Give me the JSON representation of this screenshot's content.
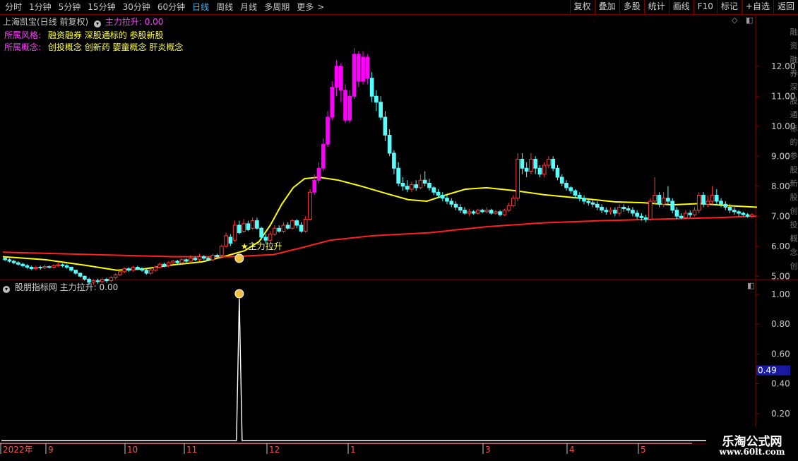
{
  "toolbar": {
    "periods": [
      "分时",
      "1分钟",
      "5分钟",
      "15分钟",
      "30分钟",
      "60分钟",
      "日线",
      "周线",
      "月线",
      "多周期",
      "更多"
    ],
    "active_period": "日线",
    "more_arrow": ">",
    "right_buttons": [
      "复权",
      "叠加",
      "多股",
      "统计",
      "画线",
      "F10",
      "标记",
      "+自选",
      "返回"
    ]
  },
  "main_panel": {
    "title": "上海凯宝(日线 前复权)",
    "indicator_label": "主力拉升: 0.00",
    "style_label": "所属风格:",
    "style_value": "融资融券 深股通标的 参股新股",
    "concept_label": "所属概念:",
    "concept_value": "创投概念 创新药 婴童概念 肝炎概念",
    "signal_text": "★主力拉升",
    "price_axis": [
      "12.00",
      "11.00",
      "10.00",
      "9.00",
      "8.00",
      "7.00",
      "6.00",
      "5.00"
    ],
    "right_strip_text": "融资融券深股通标的参股新股创投概念创新药婴童概念肝炎"
  },
  "sub_panel": {
    "title": "股朋指标网 主力拉升: 0.00",
    "axis": [
      "1.00",
      "0.80",
      "0.60",
      "0.40",
      "0.20"
    ],
    "current_value": "0.49"
  },
  "time_axis": [
    "2022年",
    "9",
    "10",
    "11",
    "12",
    "1",
    "3",
    "4",
    "5"
  ],
  "watermark": {
    "line1": "乐淘公式网",
    "line2": "www.60lt.com"
  },
  "colors": {
    "up": "#ff3c3c",
    "down": "#54ffff",
    "surge": "#ff00ff",
    "ma_short": "#ffff00",
    "ma_long": "#ff2020",
    "grid_border": "#8b0000",
    "highlight_value": "#1a1aa0"
  },
  "chart_data": {
    "type": "candlestick",
    "ylim": [
      4.5,
      12.6
    ],
    "x_ticks": [
      "2022年",
      "9",
      "10",
      "11",
      "12",
      "1",
      "3",
      "4",
      "5"
    ],
    "ma_short_points": [
      [
        0,
        5.65
      ],
      [
        30,
        5.55
      ],
      [
        60,
        5.35
      ],
      [
        80,
        5.2
      ],
      [
        100,
        5.25
      ],
      [
        120,
        5.38
      ],
      [
        140,
        5.48
      ],
      [
        155,
        5.65
      ],
      [
        170,
        5.85
      ],
      [
        180,
        6.15
      ],
      [
        188,
        6.7
      ],
      [
        196,
        7.4
      ],
      [
        204,
        7.95
      ],
      [
        212,
        8.25
      ],
      [
        222,
        8.3
      ],
      [
        236,
        8.2
      ],
      [
        252,
        8.0
      ],
      [
        270,
        7.75
      ],
      [
        285,
        7.55
      ],
      [
        298,
        7.5
      ],
      [
        312,
        7.72
      ],
      [
        325,
        7.9
      ],
      [
        340,
        7.95
      ],
      [
        360,
        7.85
      ],
      [
        380,
        7.72
      ],
      [
        410,
        7.58
      ],
      [
        430,
        7.48
      ],
      [
        450,
        7.45
      ],
      [
        470,
        7.38
      ],
      [
        490,
        7.42
      ],
      [
        510,
        7.35
      ],
      [
        530,
        7.3
      ]
    ],
    "ma_long_points": [
      [
        0,
        5.8
      ],
      [
        40,
        5.75
      ],
      [
        80,
        5.7
      ],
      [
        120,
        5.65
      ],
      [
        160,
        5.65
      ],
      [
        190,
        5.72
      ],
      [
        210,
        5.95
      ],
      [
        230,
        6.2
      ],
      [
        260,
        6.35
      ],
      [
        300,
        6.45
      ],
      [
        340,
        6.65
      ],
      [
        380,
        6.78
      ],
      [
        420,
        6.85
      ],
      [
        460,
        6.9
      ],
      [
        500,
        6.95
      ],
      [
        530,
        7.0
      ]
    ],
    "candles": [
      [
        5.6,
        5.55,
        5.65,
        5.5
      ],
      [
        5.55,
        5.5,
        5.6,
        5.45
      ],
      [
        5.5,
        5.45,
        5.55,
        5.4
      ],
      [
        5.45,
        5.4,
        5.5,
        5.35
      ],
      [
        5.4,
        5.35,
        5.45,
        5.3
      ],
      [
        5.35,
        5.3,
        5.4,
        5.25
      ],
      [
        5.3,
        5.25,
        5.35,
        5.2
      ],
      [
        5.25,
        5.3,
        5.35,
        5.2
      ],
      [
        5.3,
        5.28,
        5.35,
        5.22
      ],
      [
        5.28,
        5.32,
        5.38,
        5.24
      ],
      [
        5.32,
        5.3,
        5.36,
        5.26
      ],
      [
        5.3,
        5.35,
        5.4,
        5.26
      ],
      [
        5.35,
        5.38,
        5.45,
        5.3
      ],
      [
        5.38,
        5.35,
        5.42,
        5.3
      ],
      [
        5.35,
        5.3,
        5.4,
        5.25
      ],
      [
        5.3,
        5.2,
        5.32,
        5.15
      ],
      [
        5.2,
        5.1,
        5.22,
        5.05
      ],
      [
        5.1,
        5.0,
        5.12,
        4.95
      ],
      [
        5.0,
        4.9,
        5.02,
        4.85
      ],
      [
        4.9,
        4.8,
        4.95,
        4.7
      ],
      [
        4.8,
        4.85,
        4.9,
        4.72
      ],
      [
        4.85,
        4.82,
        4.92,
        4.75
      ],
      [
        4.82,
        4.9,
        4.95,
        4.78
      ],
      [
        4.9,
        4.85,
        4.95,
        4.78
      ],
      [
        4.85,
        4.95,
        5.0,
        4.8
      ],
      [
        4.95,
        5.05,
        5.1,
        4.9
      ],
      [
        5.05,
        5.15,
        5.2,
        5.0
      ],
      [
        5.15,
        5.25,
        5.3,
        5.1
      ],
      [
        5.25,
        5.2,
        5.3,
        5.15
      ],
      [
        5.2,
        5.3,
        5.35,
        5.15
      ],
      [
        5.3,
        5.25,
        5.35,
        5.2
      ],
      [
        5.25,
        5.2,
        5.3,
        5.15
      ],
      [
        5.2,
        5.1,
        5.25,
        5.05
      ],
      [
        5.1,
        5.2,
        5.25,
        5.05
      ],
      [
        5.2,
        5.3,
        5.35,
        5.15
      ],
      [
        5.3,
        5.4,
        5.45,
        5.25
      ],
      [
        5.4,
        5.35,
        5.45,
        5.3
      ],
      [
        5.35,
        5.45,
        5.5,
        5.3
      ],
      [
        5.45,
        5.5,
        5.55,
        5.4
      ],
      [
        5.5,
        5.45,
        5.55,
        5.4
      ],
      [
        5.45,
        5.55,
        5.6,
        5.4
      ],
      [
        5.55,
        5.5,
        5.6,
        5.45
      ],
      [
        5.5,
        5.6,
        5.7,
        5.45
      ],
      [
        5.6,
        5.55,
        5.65,
        5.5
      ],
      [
        5.55,
        5.65,
        5.75,
        5.5
      ],
      [
        5.65,
        5.6,
        5.7,
        5.55
      ],
      [
        5.6,
        5.55,
        5.65,
        5.5
      ],
      [
        5.55,
        5.7,
        5.75,
        5.5
      ],
      [
        5.7,
        5.65,
        5.75,
        5.6
      ],
      [
        5.7,
        6.0,
        6.05,
        5.65
      ],
      [
        6.0,
        6.35,
        6.45,
        5.95
      ],
      [
        6.3,
        6.1,
        6.4,
        6.0
      ],
      [
        6.2,
        6.7,
        6.85,
        6.15
      ],
      [
        6.7,
        6.45,
        6.85,
        6.4
      ],
      [
        6.5,
        6.75,
        6.9,
        6.45
      ],
      [
        6.75,
        6.55,
        6.85,
        6.5
      ],
      [
        6.6,
        6.85,
        6.95,
        6.55
      ],
      [
        6.85,
        6.6,
        6.95,
        6.55
      ],
      [
        6.6,
        6.3,
        6.65,
        6.2
      ],
      [
        6.3,
        6.2,
        6.4,
        6.1
      ],
      [
        6.2,
        6.4,
        6.5,
        6.15
      ],
      [
        6.4,
        6.6,
        6.7,
        6.35
      ],
      [
        6.6,
        6.5,
        6.7,
        6.45
      ],
      [
        6.5,
        6.7,
        6.8,
        6.45
      ],
      [
        6.7,
        6.6,
        6.8,
        6.55
      ],
      [
        6.6,
        6.85,
        6.9,
        6.55
      ],
      [
        6.85,
        6.7,
        6.9,
        6.6
      ],
      [
        6.7,
        6.5,
        6.8,
        6.45
      ],
      [
        6.5,
        6.9,
        7.0,
        6.45
      ],
      [
        6.9,
        7.8,
        7.9,
        6.85
      ],
      [
        7.8,
        8.2,
        8.4,
        7.7
      ],
      [
        8.2,
        8.6,
        8.8,
        8.1
      ],
      [
        8.6,
        9.4,
        9.6,
        8.5
      ],
      [
        9.4,
        10.3,
        10.5,
        9.3
      ],
      [
        10.3,
        11.3,
        11.5,
        10.2
      ],
      [
        11.3,
        12.0,
        12.2,
        11.0
      ],
      [
        12.0,
        11.2,
        12.1,
        10.8
      ],
      [
        11.2,
        10.2,
        11.4,
        10.1
      ],
      [
        10.2,
        11.0,
        11.2,
        10.1
      ],
      [
        11.0,
        12.4,
        12.6,
        10.9
      ],
      [
        12.4,
        11.5,
        12.5,
        11.3
      ],
      [
        11.5,
        12.3,
        12.5,
        11.4
      ],
      [
        12.3,
        11.6,
        12.4,
        11.4
      ],
      [
        11.6,
        11.0,
        11.8,
        10.8
      ],
      [
        11.0,
        10.8,
        11.2,
        10.5
      ],
      [
        10.8,
        10.3,
        11.0,
        10.2
      ],
      [
        10.3,
        9.7,
        10.5,
        9.5
      ],
      [
        9.7,
        9.1,
        9.9,
        9.0
      ],
      [
        9.1,
        8.6,
        9.2,
        8.4
      ],
      [
        8.6,
        8.1,
        8.8,
        8.0
      ],
      [
        8.1,
        8.0,
        8.3,
        7.85
      ],
      [
        8.0,
        7.9,
        8.2,
        7.8
      ],
      [
        7.9,
        8.05,
        8.15,
        7.8
      ],
      [
        8.05,
        7.95,
        8.2,
        7.85
      ],
      [
        7.95,
        8.2,
        8.4,
        7.9
      ],
      [
        8.2,
        8.1,
        8.5,
        8.0
      ],
      [
        8.1,
        7.95,
        8.25,
        7.85
      ],
      [
        7.95,
        7.8,
        8.0,
        7.7
      ],
      [
        7.8,
        7.7,
        7.9,
        7.6
      ],
      [
        7.7,
        7.6,
        7.8,
        7.5
      ],
      [
        7.6,
        7.5,
        7.7,
        7.4
      ],
      [
        7.5,
        7.4,
        7.6,
        7.3
      ],
      [
        7.4,
        7.3,
        7.5,
        7.2
      ],
      [
        7.3,
        7.2,
        7.4,
        7.1
      ],
      [
        7.2,
        7.1,
        7.3,
        7.05
      ],
      [
        7.1,
        7.15,
        7.25,
        7.0
      ],
      [
        7.15,
        7.1,
        7.2,
        7.05
      ],
      [
        7.1,
        7.2,
        7.25,
        7.05
      ],
      [
        7.2,
        7.15,
        7.25,
        7.1
      ],
      [
        7.15,
        7.2,
        7.3,
        7.1
      ],
      [
        7.2,
        7.1,
        7.25,
        7.05
      ],
      [
        7.1,
        7.15,
        7.2,
        7.05
      ],
      [
        7.15,
        7.05,
        7.2,
        7.0
      ],
      [
        7.05,
        7.2,
        7.25,
        7.0
      ],
      [
        7.2,
        7.35,
        7.45,
        7.15
      ],
      [
        7.35,
        7.6,
        7.7,
        7.3
      ],
      [
        7.6,
        8.9,
        9.1,
        7.5
      ],
      [
        8.9,
        8.6,
        9.1,
        8.4
      ],
      [
        8.6,
        8.5,
        8.8,
        8.3
      ],
      [
        8.5,
        8.9,
        9.1,
        8.4
      ],
      [
        8.9,
        8.6,
        9.0,
        8.4
      ],
      [
        8.6,
        8.4,
        8.7,
        8.3
      ],
      [
        8.4,
        8.7,
        8.8,
        8.3
      ],
      [
        8.7,
        8.9,
        9.0,
        8.6
      ],
      [
        8.9,
        8.6,
        9.0,
        8.5
      ],
      [
        8.6,
        8.3,
        8.7,
        8.2
      ],
      [
        8.3,
        8.1,
        8.4,
        8.0
      ],
      [
        8.1,
        7.95,
        8.2,
        7.85
      ],
      [
        7.95,
        7.85,
        8.0,
        7.75
      ],
      [
        7.85,
        7.7,
        7.9,
        7.6
      ],
      [
        7.7,
        7.6,
        7.8,
        7.5
      ],
      [
        7.6,
        7.5,
        7.7,
        7.4
      ],
      [
        7.5,
        7.45,
        7.6,
        7.35
      ],
      [
        7.45,
        7.4,
        7.55,
        7.3
      ],
      [
        7.4,
        7.3,
        7.5,
        7.2
      ],
      [
        7.3,
        7.2,
        7.4,
        7.1
      ],
      [
        7.2,
        7.15,
        7.3,
        7.05
      ],
      [
        7.15,
        7.2,
        7.3,
        7.05
      ],
      [
        7.2,
        7.1,
        7.3,
        7.0
      ],
      [
        7.1,
        7.3,
        7.4,
        7.0
      ],
      [
        7.3,
        7.25,
        7.4,
        7.15
      ],
      [
        7.25,
        7.2,
        7.35,
        7.1
      ],
      [
        7.2,
        7.1,
        7.3,
        7.0
      ],
      [
        7.1,
        7.0,
        7.2,
        6.9
      ],
      [
        7.0,
        6.95,
        7.1,
        6.85
      ],
      [
        6.95,
        6.9,
        7.05,
        6.8
      ],
      [
        6.9,
        7.5,
        7.6,
        6.85
      ],
      [
        7.5,
        7.7,
        8.3,
        7.4
      ],
      [
        7.7,
        7.4,
        7.8,
        7.3
      ],
      [
        7.4,
        7.6,
        7.8,
        7.3
      ],
      [
        7.6,
        7.5,
        8.0,
        7.4
      ],
      [
        7.5,
        7.2,
        7.6,
        7.1
      ],
      [
        7.2,
        7.0,
        7.3,
        6.9
      ],
      [
        7.0,
        6.95,
        7.1,
        6.9
      ],
      [
        6.95,
        7.1,
        7.2,
        6.9
      ],
      [
        7.1,
        7.05,
        7.2,
        6.95
      ],
      [
        7.05,
        7.2,
        7.3,
        7.0
      ],
      [
        7.2,
        7.7,
        7.8,
        7.1
      ],
      [
        7.7,
        7.4,
        7.8,
        7.3
      ],
      [
        7.4,
        7.5,
        7.7,
        7.3
      ],
      [
        7.5,
        7.7,
        8.0,
        7.4
      ],
      [
        7.7,
        7.5,
        7.9,
        7.4
      ],
      [
        7.5,
        7.4,
        7.6,
        7.3
      ],
      [
        7.4,
        7.3,
        7.5,
        7.2
      ],
      [
        7.3,
        7.2,
        7.4,
        7.1
      ],
      [
        7.2,
        7.15,
        7.3,
        7.05
      ],
      [
        7.15,
        7.1,
        7.2,
        7.0
      ],
      [
        7.1,
        7.05,
        7.15,
        7.0
      ],
      [
        7.05,
        7.0,
        7.1,
        6.95
      ],
      [
        7.0,
        7.05,
        7.1,
        6.95
      ]
    ],
    "surge_from": 70,
    "surge_to": 82,
    "sub_signal_index": 53
  }
}
